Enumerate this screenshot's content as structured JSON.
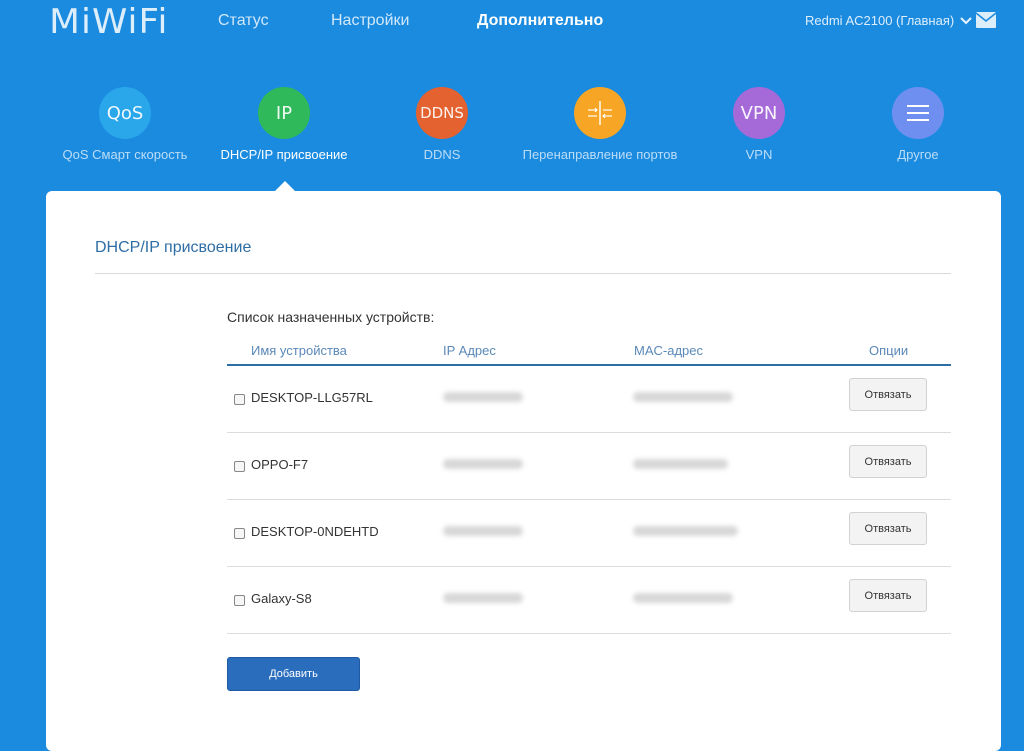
{
  "header": {
    "logo": "MiWiFi",
    "nav": [
      {
        "label": "Статус"
      },
      {
        "label": "Настройки"
      },
      {
        "label": "Дополнительно"
      }
    ],
    "router": "Redmi AC2100 (Главная)"
  },
  "features": [
    {
      "icon_text": "QoS",
      "label": "QoS Смарт скорость",
      "color": "#2aa6ea"
    },
    {
      "icon_text": "IP",
      "label": "DHCP/IP присвоение",
      "color": "#2fb95a"
    },
    {
      "icon_text": "DDNS",
      "label": "DDNS",
      "color": "#e3622f"
    },
    {
      "icon_text": "",
      "icon": "port-forward-icon",
      "label": "Перенаправление портов",
      "color": "#f6a524"
    },
    {
      "icon_text": "VPN",
      "label": "VPN",
      "color": "#a56ad8"
    },
    {
      "icon_text": "",
      "icon": "menu-icon",
      "label": "Другое",
      "color": "#6f8ff0"
    }
  ],
  "panel": {
    "title": "DHCP/IP присвоение",
    "list_caption": "Список назначенных устройств:",
    "columns": {
      "name": "Имя устройства",
      "ip": "IP Адрес",
      "mac": "MAC-адрес",
      "options": "Опции"
    },
    "rows": [
      {
        "name": "DESKTOP-LLG57RL",
        "unbind": "Отвязать"
      },
      {
        "name": "OPPO-F7",
        "unbind": "Отвязать"
      },
      {
        "name": "DESKTOP-0NDEHTD",
        "unbind": "Отвязать"
      },
      {
        "name": "Galaxy-S8",
        "unbind": "Отвязать"
      }
    ],
    "add_button": "Добавить"
  }
}
